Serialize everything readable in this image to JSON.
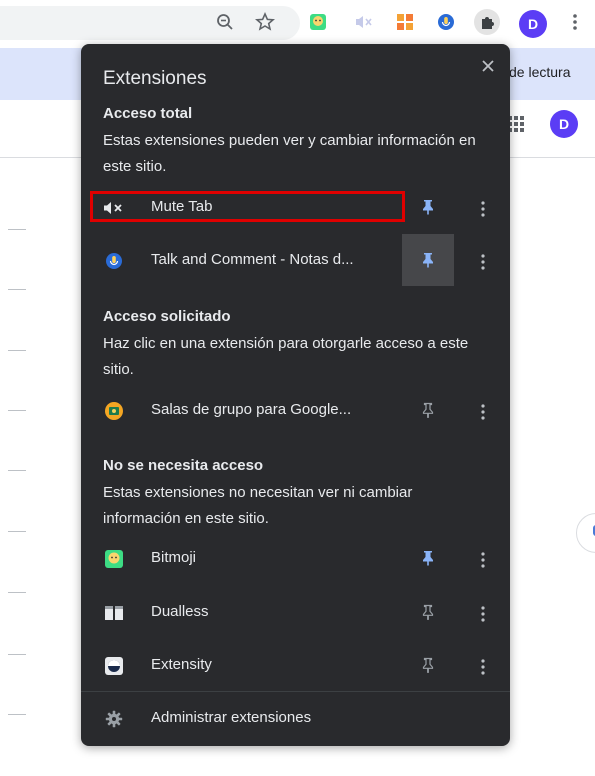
{
  "browser": {
    "profile_initial": "D",
    "reading_list_label": "de lectura",
    "colors": {
      "avatar": "#5b3df5",
      "bookmark_bar": "#dce4fb"
    },
    "toolbar_icons": [
      "zoom-out-icon",
      "star-icon",
      "bitmoji-icon",
      "mute-tab-icon",
      "dualless-icon",
      "talk-and-comment-icon",
      "extensions-puzzle-icon",
      "avatar",
      "kebab-menu-icon"
    ]
  },
  "popup": {
    "title": "Extensiones",
    "close_icon": "close-icon",
    "colors": {
      "background": "#292a2d",
      "pin_active": "#8ab4f8",
      "highlight": "#e00000"
    },
    "sections": [
      {
        "title": "Acceso total",
        "description": "Estas extensiones pueden ver y cambiar información en este sitio.",
        "items": [
          {
            "name": "Mute Tab",
            "icon": "speaker-mute-icon",
            "pinned": true,
            "highlighted": true
          },
          {
            "name": "Talk and Comment - Notas d...",
            "icon": "talk-and-comment-icon",
            "pinned": true,
            "pin_hover": true
          }
        ]
      },
      {
        "title": "Acceso solicitado",
        "description": "Haz clic en una extensión para otorgarle acceso a este sitio.",
        "items": [
          {
            "name": "Salas de grupo para Google...",
            "icon": "breakout-rooms-icon",
            "pinned": false
          }
        ]
      },
      {
        "title": "No se necesita acceso",
        "description": "Estas extensiones no necesitan ver ni cambiar información en este sitio.",
        "items": [
          {
            "name": "Bitmoji",
            "icon": "bitmoji-icon",
            "pinned": true
          },
          {
            "name": "Dualless",
            "icon": "dualless-icon",
            "pinned": false
          },
          {
            "name": "Extensity",
            "icon": "extensity-icon",
            "pinned": false
          }
        ]
      }
    ],
    "manage_label": "Administrar extensiones",
    "manage_icon": "gear-icon"
  }
}
